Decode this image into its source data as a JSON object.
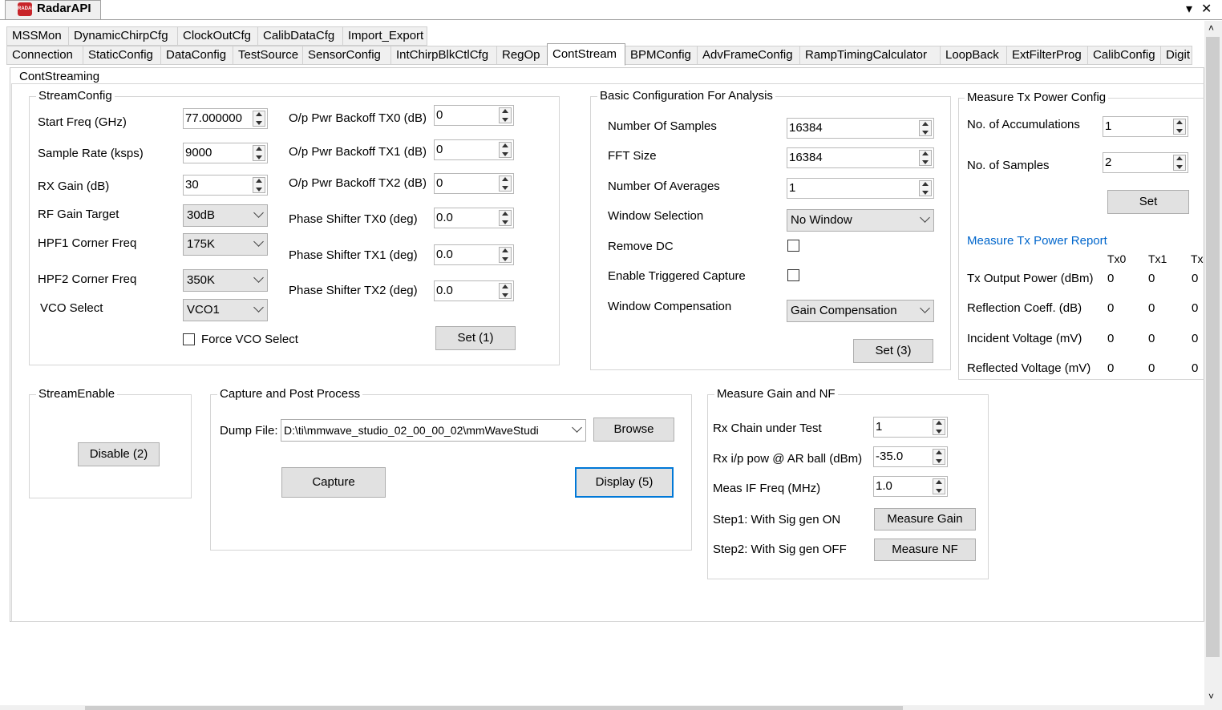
{
  "window": {
    "title": "RadarAPI",
    "logo": "RADAR",
    "pin_glyph": "▾",
    "close_glyph": "✕"
  },
  "tabs_row1": [
    "MSSMon",
    "DynamicChirpCfg",
    "ClockOutCfg",
    "CalibDataCfg",
    "Import_Export"
  ],
  "tabs_row2": [
    "Connection",
    "StaticConfig",
    "DataConfig",
    "TestSource",
    "SensorConfig",
    "IntChirpBlkCtlCfg",
    "RegOp",
    "ContStream",
    "BPMConfig",
    "AdvFrameConfig",
    "RampTimingCalculator",
    "LoopBack",
    "ExtFilterProg",
    "CalibConfig",
    "Digit"
  ],
  "active_tab": "ContStream",
  "cont": {
    "group_label": "ContStreaming",
    "stream": {
      "label": "StreamConfig",
      "start_freq_label": "Start Freq (GHz)",
      "start_freq": "77.000000",
      "sample_rate_label": "Sample Rate (ksps)",
      "sample_rate": "9000",
      "rx_gain_label": "RX Gain (dB)",
      "rx_gain": "30",
      "rf_gain_label": "RF Gain Target",
      "rf_gain": "30dB",
      "hpf1_label": "HPF1 Corner Freq",
      "hpf1": "175K",
      "hpf2_label": "HPF2 Corner Freq",
      "hpf2": "350K",
      "vco_label": "VCO Select",
      "vco": "VCO1",
      "force_vco_label": "Force VCO Select",
      "backoff_tx0_label": "O/p Pwr Backoff TX0 (dB)",
      "backoff_tx0": "0",
      "backoff_tx1_label": "O/p Pwr Backoff TX1 (dB)",
      "backoff_tx1": "0",
      "backoff_tx2_label": "O/p Pwr Backoff TX2 (dB)",
      "backoff_tx2": "0",
      "phase_tx0_label": "Phase Shifter TX0 (deg)",
      "phase_tx0": "0.0",
      "phase_tx1_label": "Phase Shifter TX1 (deg)",
      "phase_tx1": "0.0",
      "phase_tx2_label": "Phase Shifter TX2 (deg)",
      "phase_tx2": "0.0",
      "set_button": "Set (1)"
    },
    "basic": {
      "label": "Basic Configuration For Analysis",
      "num_samples_label": "Number Of Samples",
      "num_samples": "16384",
      "fft_label": "FFT Size",
      "fft": "16384",
      "averages_label": "Number Of Averages",
      "averages": "1",
      "window_label": "Window Selection",
      "window": "No Window",
      "remove_dc_label": "Remove DC",
      "trig_label": "Enable Triggered Capture",
      "comp_label": "Window Compensation",
      "comp": "Gain Compensation",
      "set_button": "Set (3)"
    },
    "txpower": {
      "label": "Measure Tx Power Config",
      "accum_label": "No. of Accumulations",
      "accum": "1",
      "samples_label": "No. of Samples",
      "samples": "2",
      "set_button": "Set",
      "report_label": "Measure Tx Power Report",
      "cols": [
        "Tx0",
        "Tx1",
        "Tx"
      ],
      "rows": [
        {
          "label": "Tx Output Power (dBm)",
          "v": [
            "0",
            "0",
            "0"
          ]
        },
        {
          "label": "Reflection Coeff.  (dB)",
          "v": [
            "0",
            "0",
            "0"
          ]
        },
        {
          "label": "Incident Voltage (mV)",
          "v": [
            "0",
            "0",
            "0"
          ]
        },
        {
          "label": "Reflected Voltage (mV)",
          "v": [
            "0",
            "0",
            "0"
          ]
        }
      ]
    },
    "enable": {
      "label": "StreamEnable",
      "button": "Disable (2)"
    },
    "capture": {
      "label": "Capture and Post Process",
      "dump_label": "Dump File:",
      "dump_value": "D:\\ti\\mmwave_studio_02_00_00_02\\mmWaveStudi",
      "browse": "Browse",
      "capture": "Capture",
      "display": "Display (5)"
    },
    "gain": {
      "label": "Measure Gain and NF",
      "rx_chain_label": "Rx Chain under Test",
      "rx_chain": "1",
      "rx_pow_label": "Rx i/p pow @ AR ball (dBm)",
      "rx_pow": "-35.0",
      "if_freq_label": "Meas IF Freq (MHz)",
      "if_freq": "1.0",
      "step1_label": "Step1: With Sig gen ON",
      "measure_gain": "Measure Gain",
      "step2_label": "Step2: With Sig gen OFF",
      "measure_nf": "Measure NF"
    }
  }
}
